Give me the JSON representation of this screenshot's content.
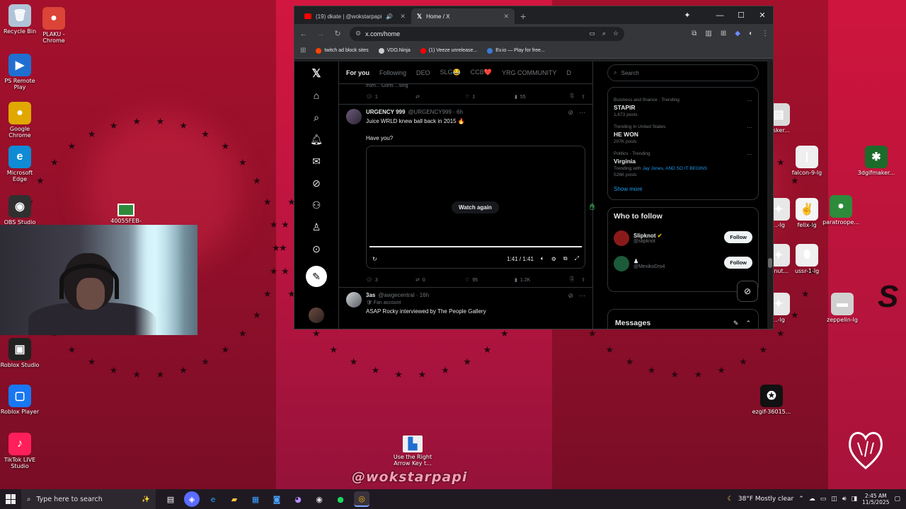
{
  "desktop": {
    "icons_left": [
      {
        "label": "Recycle Bin",
        "glyph": "🗑",
        "color": "#b0c4d8"
      },
      {
        "label": "PLAKU - Chrome",
        "glyph": "●",
        "color": "#db4437"
      },
      {
        "label": "PS Remote Play",
        "glyph": "▶",
        "color": "#1f6fd1"
      },
      {
        "label": "Google Chrome",
        "glyph": "●",
        "color": "#e0a800"
      },
      {
        "label": "Microsoft Edge",
        "glyph": "e",
        "color": "#0f8bd6"
      },
      {
        "label": "OBS Studio",
        "glyph": "◉",
        "color": "#303030"
      },
      {
        "label": "Roblox Studio",
        "glyph": "▣",
        "color": "#222222"
      },
      {
        "label": "Roblox Player",
        "glyph": "▢",
        "color": "#1877f2"
      },
      {
        "label": "TikTok LIVE Studio",
        "glyph": "♪",
        "color": "#ff1f5a"
      }
    ],
    "icons_right": [
      {
        "label": "...sker...",
        "glyph": "▤",
        "color": "#d9d9d9"
      },
      {
        "label": "falcon-9-lg",
        "glyph": "|",
        "color": "#efefef"
      },
      {
        "label": "3dgifmaker...",
        "glyph": "✱",
        "color": "#1c6b2a"
      },
      {
        "label": "...-lg",
        "glyph": "✦",
        "color": "#e8e8e8"
      },
      {
        "label": "felix-lg",
        "glyph": "✌",
        "color": "#f5f5f5"
      },
      {
        "label": "paratroope...",
        "glyph": "●",
        "color": "#2e8b3c"
      },
      {
        "label": "...nut...",
        "glyph": "✦",
        "color": "#e8e8e8"
      },
      {
        "label": "ussr-1-lg",
        "glyph": "⬮",
        "color": "#f0f0f0"
      },
      {
        "label": "...-lg",
        "glyph": "✦",
        "color": "#e8e8e8"
      },
      {
        "label": "zeppelin-lg",
        "glyph": "▬",
        "color": "#d0d0d0"
      },
      {
        "label": "ezgif-36015...",
        "glyph": "✪",
        "color": "#111111"
      }
    ],
    "file_icon_label": "40055FEB-5...",
    "shortcut_label": "Use the Right Arrow Key t...",
    "watermark": "@wokstarpapi"
  },
  "browser": {
    "tabs": [
      {
        "title": "(19) dkate | @wokstarpapi",
        "active": false,
        "fav_color": "#ff0000"
      },
      {
        "title": "Home / X",
        "active": true,
        "fav_color": "#ffffff"
      }
    ],
    "new_tab": "+",
    "url": "x.com/home",
    "bookmarks": [
      {
        "label": "twitch ad block sites",
        "color": "#ff4500"
      },
      {
        "label": "VDO.Ninja",
        "color": "#cccccc"
      },
      {
        "label": "(1) Veeze unrelease...",
        "color": "#ff0000"
      },
      {
        "label": "Ev.io — Play for free...",
        "color": "#3a7bd5"
      }
    ]
  },
  "x": {
    "feed_tabs": [
      "For you",
      "Following",
      "DEO",
      "SLG😂",
      "CCB❤️",
      "YRG COMMUNITY",
      "D"
    ],
    "prev_post": {
      "fragment": "from... Gorts ...sing",
      "replies": "1",
      "reposts": "",
      "likes": "1",
      "views": "55"
    },
    "post1": {
      "name": "URGENCY 999",
      "handle": "@URGENCY999 · 6h",
      "text": "Juice WRLD knew ball back in 2015 🔥",
      "text2": "Have you?",
      "watch_again": "Watch again",
      "time": "1:41 / 1:41",
      "replies": "3",
      "reposts": "0",
      "likes": "95",
      "views": "1.2K"
    },
    "post2": {
      "name": "3as",
      "handle": "@awgecentral · 16h",
      "badge": "Fan account",
      "text": "ASAP Rocky interviewed by The People Gallery"
    },
    "search_placeholder": "Search",
    "trends": [
      {
        "context": "Business and finance · Trending",
        "topic": "STAPIR",
        "sub": "1,673 posts",
        "link": ""
      },
      {
        "context": "Trending in United States",
        "topic": "HE WON",
        "sub": "207K posts",
        "link": ""
      },
      {
        "context": "Politics · Trending",
        "topic": "Virginia",
        "sub": "Trending with ",
        "link": "Jay Jones, AND SO IT BEGINS"
      },
      {
        "context": "",
        "topic": "",
        "sub": "526K posts",
        "link": ""
      }
    ],
    "show_more": "Show more",
    "who_to_follow": "Who to follow",
    "accounts": [
      {
        "name": "Slipknot",
        "handle": "@slipknot",
        "follow": "Follow",
        "color": "#8a1a1a"
      },
      {
        "name": "",
        "handle": "@MexikoDro4",
        "follow": "Follow",
        "color": "#1b5b3a"
      }
    ],
    "messages": "Messages"
  },
  "taskbar": {
    "search_placeholder": "Type here to search",
    "weather": "38°F  Mostly clear",
    "time": "2:45 AM",
    "date": "11/5/2025"
  }
}
